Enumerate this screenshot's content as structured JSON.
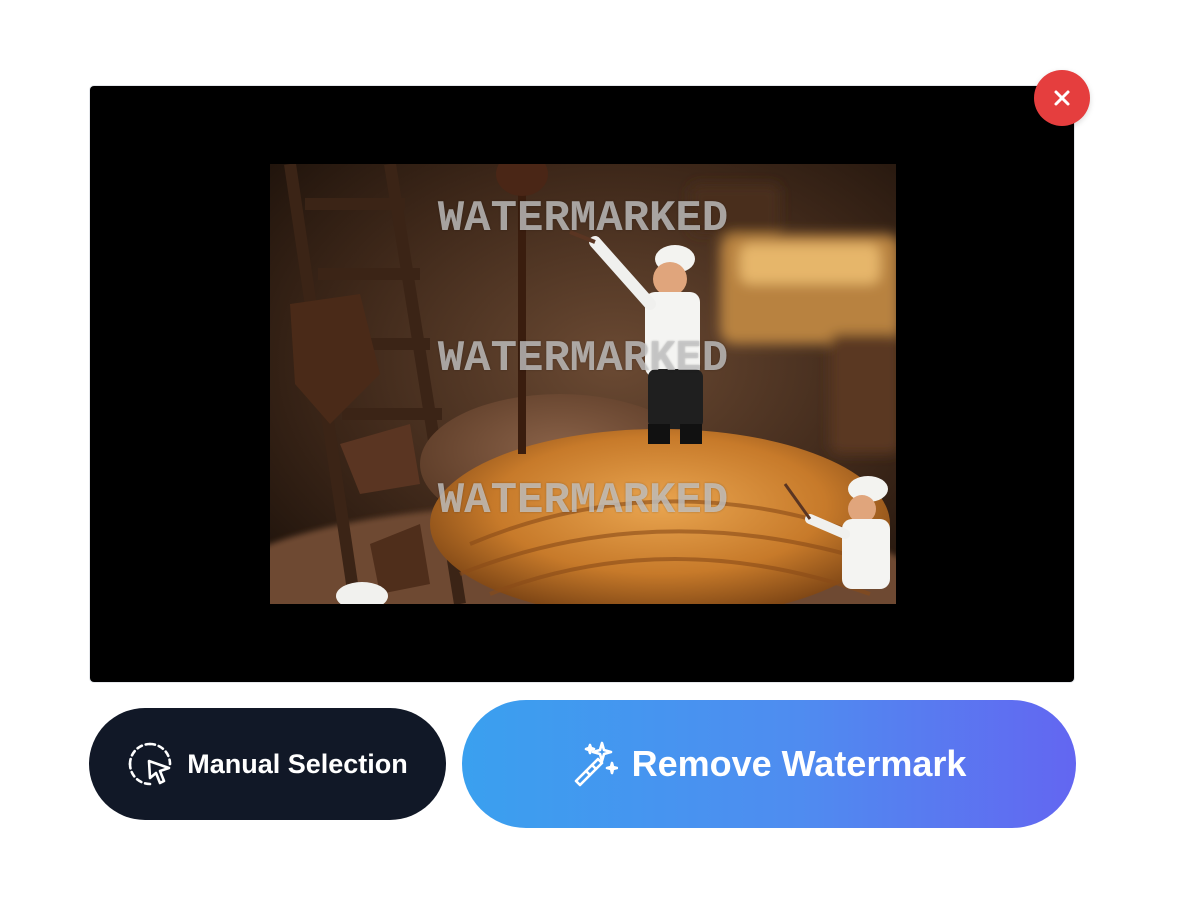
{
  "image": {
    "description": "miniature chefs on chocolate-covered croissant",
    "watermark_text": "WATERMARKED",
    "watermarks": [
      "WATERMARKED",
      "WATERMARKED",
      "WATERMARKED"
    ]
  },
  "close_button": {
    "icon": "close-icon",
    "color": "#e53e3e"
  },
  "actions": {
    "manual_label": "Manual Selection",
    "manual_icon": "pointer-select-icon",
    "remove_label": "Remove Watermark",
    "remove_icon": "magic-wand-icon",
    "manual_bg": "#111827",
    "remove_gradient": [
      "#3aa0ef",
      "#6366f1"
    ]
  }
}
